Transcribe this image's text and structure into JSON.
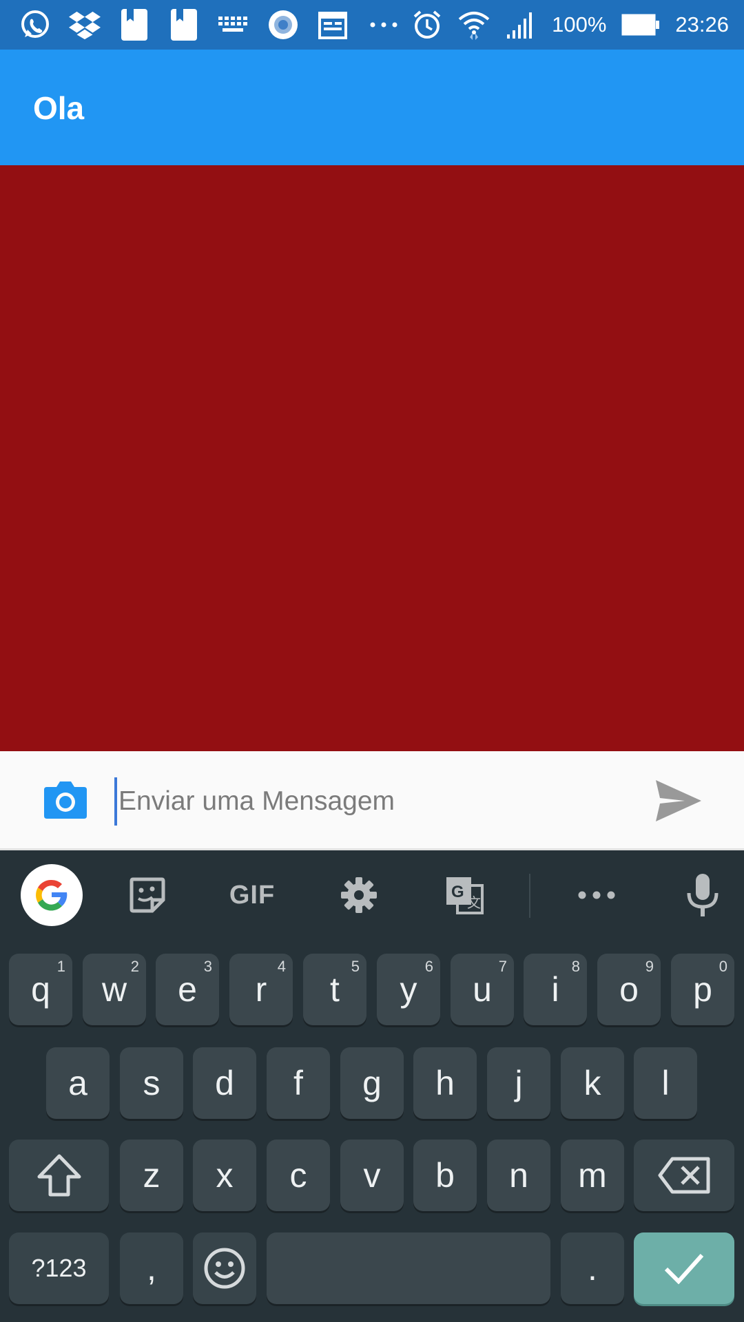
{
  "status_bar": {
    "notification_icons": [
      "whatsapp-icon",
      "dropbox-icon",
      "book-icon",
      "book-icon",
      "keyboard-icon",
      "record-icon",
      "calendar-icon",
      "more-dots-icon"
    ],
    "alarm_icon": "alarm-icon",
    "wifi_icon": "wifi-icon",
    "signal_icon": "signal-icon",
    "battery_percent": "100%",
    "battery_icon": "battery-icon",
    "time": "23:26",
    "color": "#1f70bc"
  },
  "app_bar": {
    "title": "Ola",
    "color": "#2196f3"
  },
  "content": {
    "background": "#930f12"
  },
  "composer": {
    "camera_icon": "camera-icon",
    "placeholder": "Enviar uma Mensagem",
    "value": "",
    "send_icon": "send-icon",
    "accent": "#2196f3"
  },
  "keyboard": {
    "toolbar": [
      "google-icon",
      "sticker-icon",
      "GIF",
      "settings-icon",
      "translate-icon",
      "more-icon",
      "mic-icon"
    ],
    "row1": [
      {
        "label": "q",
        "alt": "1"
      },
      {
        "label": "w",
        "alt": "2"
      },
      {
        "label": "e",
        "alt": "3"
      },
      {
        "label": "r",
        "alt": "4"
      },
      {
        "label": "t",
        "alt": "5"
      },
      {
        "label": "y",
        "alt": "6"
      },
      {
        "label": "u",
        "alt": "7"
      },
      {
        "label": "i",
        "alt": "8"
      },
      {
        "label": "o",
        "alt": "9"
      },
      {
        "label": "p",
        "alt": "0"
      }
    ],
    "row2": [
      "a",
      "s",
      "d",
      "f",
      "g",
      "h",
      "j",
      "k",
      "l"
    ],
    "row3": [
      "z",
      "x",
      "c",
      "v",
      "b",
      "n",
      "m"
    ],
    "symbols_label": "?123",
    "comma_label": ",",
    "period_label": ".",
    "shift_icon": "shift-icon",
    "backspace_icon": "backspace-icon",
    "emoji_icon": "emoji-icon",
    "enter_icon": "check-icon",
    "enter_color": "#6dafa8"
  }
}
